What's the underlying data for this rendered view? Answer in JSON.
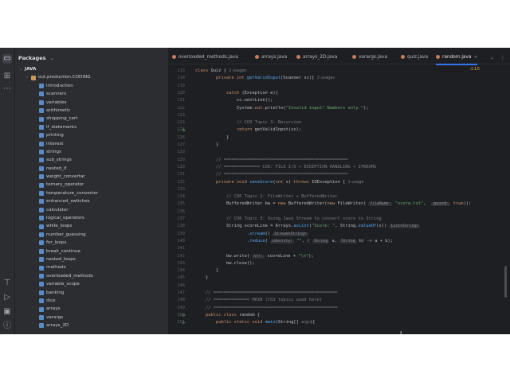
{
  "panel": {
    "title": "Packages",
    "chevron": "⌄"
  },
  "tree": [
    {
      "label": "JAVA",
      "arrow": "⌄",
      "icon": "none",
      "bold": true,
      "level": 0
    },
    {
      "label": "out.production.CODING",
      "arrow": "›",
      "icon": "folder-out",
      "level": 1
    },
    {
      "label": "introduction",
      "icon": "folder",
      "level": 2
    },
    {
      "label": "scanners",
      "icon": "folder",
      "level": 2
    },
    {
      "label": "variables",
      "icon": "folder",
      "level": 2
    },
    {
      "label": "arithimetic",
      "icon": "folder",
      "level": 2
    },
    {
      "label": "shopping_cart",
      "icon": "folder",
      "level": 2
    },
    {
      "label": "if_statements",
      "icon": "folder",
      "level": 2
    },
    {
      "label": "printing",
      "icon": "folder",
      "level": 2
    },
    {
      "label": "interest",
      "icon": "folder",
      "level": 2
    },
    {
      "label": "strings",
      "icon": "folder",
      "level": 2
    },
    {
      "label": "sub_strings",
      "icon": "folder",
      "level": 2
    },
    {
      "label": "nested_if",
      "icon": "folder",
      "level": 2
    },
    {
      "label": "weight_convertar",
      "icon": "folder",
      "level": 2
    },
    {
      "label": "ternary_operator",
      "icon": "folder",
      "level": 2
    },
    {
      "label": "temperature_converter",
      "icon": "folder",
      "level": 2
    },
    {
      "label": "enhanced_switches",
      "icon": "folder",
      "level": 2
    },
    {
      "label": "calculator",
      "icon": "folder",
      "level": 2
    },
    {
      "label": "logical_operators",
      "icon": "folder",
      "level": 2
    },
    {
      "label": "while_loops",
      "icon": "folder",
      "level": 2
    },
    {
      "label": "number_guessing",
      "icon": "folder",
      "level": 2
    },
    {
      "label": "for_loops",
      "icon": "folder",
      "level": 2
    },
    {
      "label": "break_continue",
      "icon": "folder",
      "level": 2
    },
    {
      "label": "nested_loops",
      "icon": "folder",
      "level": 2
    },
    {
      "label": "methods",
      "icon": "folder",
      "level": 2
    },
    {
      "label": "overloaded_methods",
      "icon": "folder",
      "level": 2
    },
    {
      "label": "variable_scope",
      "icon": "folder",
      "level": 2
    },
    {
      "label": "banking",
      "icon": "folder",
      "level": 2
    },
    {
      "label": "dice",
      "icon": "folder",
      "level": 2
    },
    {
      "label": "arrays",
      "icon": "folder",
      "level": 2
    },
    {
      "label": "varargs",
      "icon": "folder",
      "level": 2
    },
    {
      "label": "arrays_2D",
      "icon": "folder",
      "level": 2
    }
  ],
  "tabs": [
    {
      "label": "overloaded_methods.java",
      "active": false
    },
    {
      "label": "arrays.java",
      "active": false
    },
    {
      "label": "arrays_2D.java",
      "active": false
    },
    {
      "label": "varargs.java",
      "active": false
    },
    {
      "label": "quiz.java",
      "active": false
    },
    {
      "label": "random.java",
      "active": true
    }
  ],
  "tab_controls": {
    "dropdown": "⌄",
    "menu": "⋮"
  },
  "warnings": "⚠10",
  "colors": {
    "accent": "#3574f0",
    "bg": "#1e1f22",
    "panel": "#2b2d30"
  },
  "lines": [
    {
      "n": "113",
      "parts": [
        [
          "kw",
          "class "
        ],
        [
          "ty",
          "Quiz { "
        ],
        [
          "us",
          "2 usages"
        ]
      ]
    },
    {
      "n": "114",
      "parts": [
        [
          "ty",
          "        "
        ],
        [
          "kw",
          "private int "
        ],
        [
          "fn",
          "getValidInput"
        ],
        [
          "ty",
          "(Scanner sc){ "
        ],
        [
          "us",
          "3 usages"
        ]
      ]
    },
    {
      "n": "119",
      "parts": []
    },
    {
      "n": "120",
      "parts": [
        [
          "ty",
          "            "
        ],
        [
          "kw",
          "catch "
        ],
        [
          "ty",
          "(Exception e){"
        ]
      ]
    },
    {
      "n": "121",
      "parts": [
        [
          "ty",
          "                sc.nextLine();"
        ]
      ]
    },
    {
      "n": "122",
      "parts": [
        [
          "ty",
          "                System."
        ],
        [
          "kw",
          "out"
        ],
        [
          "ty",
          ".println("
        ],
        [
          "st",
          "\"Invalid input! Numbers only.\""
        ],
        [
          "ty",
          ");"
        ]
      ]
    },
    {
      "n": "123",
      "parts": []
    },
    {
      "n": "124",
      "parts": [
        [
          "ty",
          "                "
        ],
        [
          "cm",
          "// CO3 Topic 3: Recursion"
        ]
      ]
    },
    {
      "n": "125",
      "parts": [
        [
          "ty",
          "                "
        ],
        [
          "kw",
          "return "
        ],
        [
          "ty",
          "getValidInput(sc);"
        ]
      ],
      "icon": "↻"
    },
    {
      "n": "126",
      "parts": [
        [
          "ty",
          "            }"
        ]
      ]
    },
    {
      "n": "127",
      "parts": [
        [
          "ty",
          "        }"
        ]
      ]
    },
    {
      "n": "128",
      "parts": []
    },
    {
      "n": "129",
      "parts": [
        [
          "ty",
          "        "
        ],
        [
          "cm",
          "// ================================================"
        ]
      ]
    },
    {
      "n": "130",
      "parts": [
        [
          "ty",
          "        "
        ],
        [
          "cm",
          "// ============== CO6: FILE I/O + EXCEPTION HANDLING + STREAMS"
        ]
      ]
    },
    {
      "n": "131",
      "parts": [
        [
          "ty",
          "        "
        ],
        [
          "cm",
          "// ================================================"
        ]
      ]
    },
    {
      "n": "132",
      "parts": [
        [
          "ty",
          "        "
        ],
        [
          "kw",
          "private void "
        ],
        [
          "fn",
          "saveScore"
        ],
        [
          "ty",
          "("
        ],
        [
          "kw",
          "int "
        ],
        [
          "ty",
          "s) "
        ],
        [
          "kw",
          "throws "
        ],
        [
          "ty",
          "IOException { "
        ],
        [
          "us",
          "1 usage"
        ]
      ]
    },
    {
      "n": "133",
      "parts": []
    },
    {
      "n": "134",
      "parts": [
        [
          "ty",
          "            "
        ],
        [
          "cm",
          "// CO6 Topic 2: FileWriter + BufferedWriter"
        ]
      ]
    },
    {
      "n": "135",
      "parts": [
        [
          "ty",
          "            BufferedWriter bw = "
        ],
        [
          "kw",
          "new "
        ],
        [
          "ty",
          "BufferedWriter("
        ],
        [
          "kw",
          "new "
        ],
        [
          "ty",
          "FileWriter( "
        ],
        [
          "hi",
          "fileName:"
        ],
        [
          "st",
          " \"score.txt\""
        ],
        [
          "ty",
          ",  "
        ],
        [
          "hi",
          "append:"
        ],
        [
          "kw",
          " true"
        ],
        [
          "ty",
          "));"
        ]
      ]
    },
    {
      "n": "136",
      "parts": []
    },
    {
      "n": "137",
      "parts": [
        [
          "ty",
          "            "
        ],
        [
          "cm",
          "// CO6 Topic 3: Using Java Stream to convert score to String"
        ]
      ]
    },
    {
      "n": "138",
      "parts": [
        [
          "ty",
          "            String scoreLine = Arrays."
        ],
        [
          "fn",
          "asList"
        ],
        [
          "ty",
          "("
        ],
        [
          "st",
          "\"Score: \""
        ],
        [
          "ty",
          ", String."
        ],
        [
          "fn",
          "valueOf"
        ],
        [
          "ty",
          "(s)) "
        ],
        [
          "hi",
          "List<String>"
        ]
      ]
    },
    {
      "n": "139",
      "parts": [
        [
          "ty",
          "                    ."
        ],
        [
          "fn",
          "stream"
        ],
        [
          "ty",
          "() "
        ],
        [
          "hi",
          "Stream<String>"
        ]
      ]
    },
    {
      "n": "140",
      "parts": [
        [
          "ty",
          "                    ."
        ],
        [
          "fn",
          "reduce"
        ],
        [
          "ty",
          "( "
        ],
        [
          "hi",
          "identity:"
        ],
        [
          "st",
          " \"\""
        ],
        [
          "ty",
          ", ( "
        ],
        [
          "hi",
          "String"
        ],
        [
          "ty",
          " a, "
        ],
        [
          "hi",
          "String"
        ],
        [
          "ty",
          " b) -> a + b);"
        ]
      ]
    },
    {
      "n": "141",
      "parts": []
    },
    {
      "n": "142",
      "parts": [
        [
          "ty",
          "            bw.write( "
        ],
        [
          "hi",
          "str:"
        ],
        [
          "ty",
          " scoreLine + "
        ],
        [
          "st",
          "\"\\n\""
        ],
        [
          "ty",
          ");"
        ]
      ]
    },
    {
      "n": "143",
      "parts": [
        [
          "ty",
          "            bw.close();"
        ]
      ]
    },
    {
      "n": "144",
      "parts": [
        [
          "ty",
          "        }"
        ]
      ]
    },
    {
      "n": "145",
      "parts": [
        [
          "ty",
          "    }"
        ]
      ]
    },
    {
      "n": "146",
      "parts": []
    },
    {
      "n": "147",
      "parts": [
        [
          "cm",
          "    // ================================================"
        ]
      ]
    },
    {
      "n": "148",
      "parts": [
        [
          "cm",
          "    // ============== MAIN (CO1 topics used here)"
        ]
      ]
    },
    {
      "n": "149",
      "parts": [
        [
          "cm",
          "    // ================================================"
        ]
      ]
    },
    {
      "n": "150",
      "parts": [
        [
          "kw",
          "    public class "
        ],
        [
          "ty",
          "random {"
        ]
      ],
      "icon": "▷"
    },
    {
      "n": "151",
      "parts": [
        [
          "kw",
          "        public static void "
        ],
        [
          "fn",
          "main"
        ],
        [
          "ty",
          "(String[] "
        ],
        [
          "us",
          "args"
        ],
        [
          "ty",
          ")"
        ],
        [
          "ty",
          "{"
        ]
      ],
      "icon": "▷"
    }
  ]
}
